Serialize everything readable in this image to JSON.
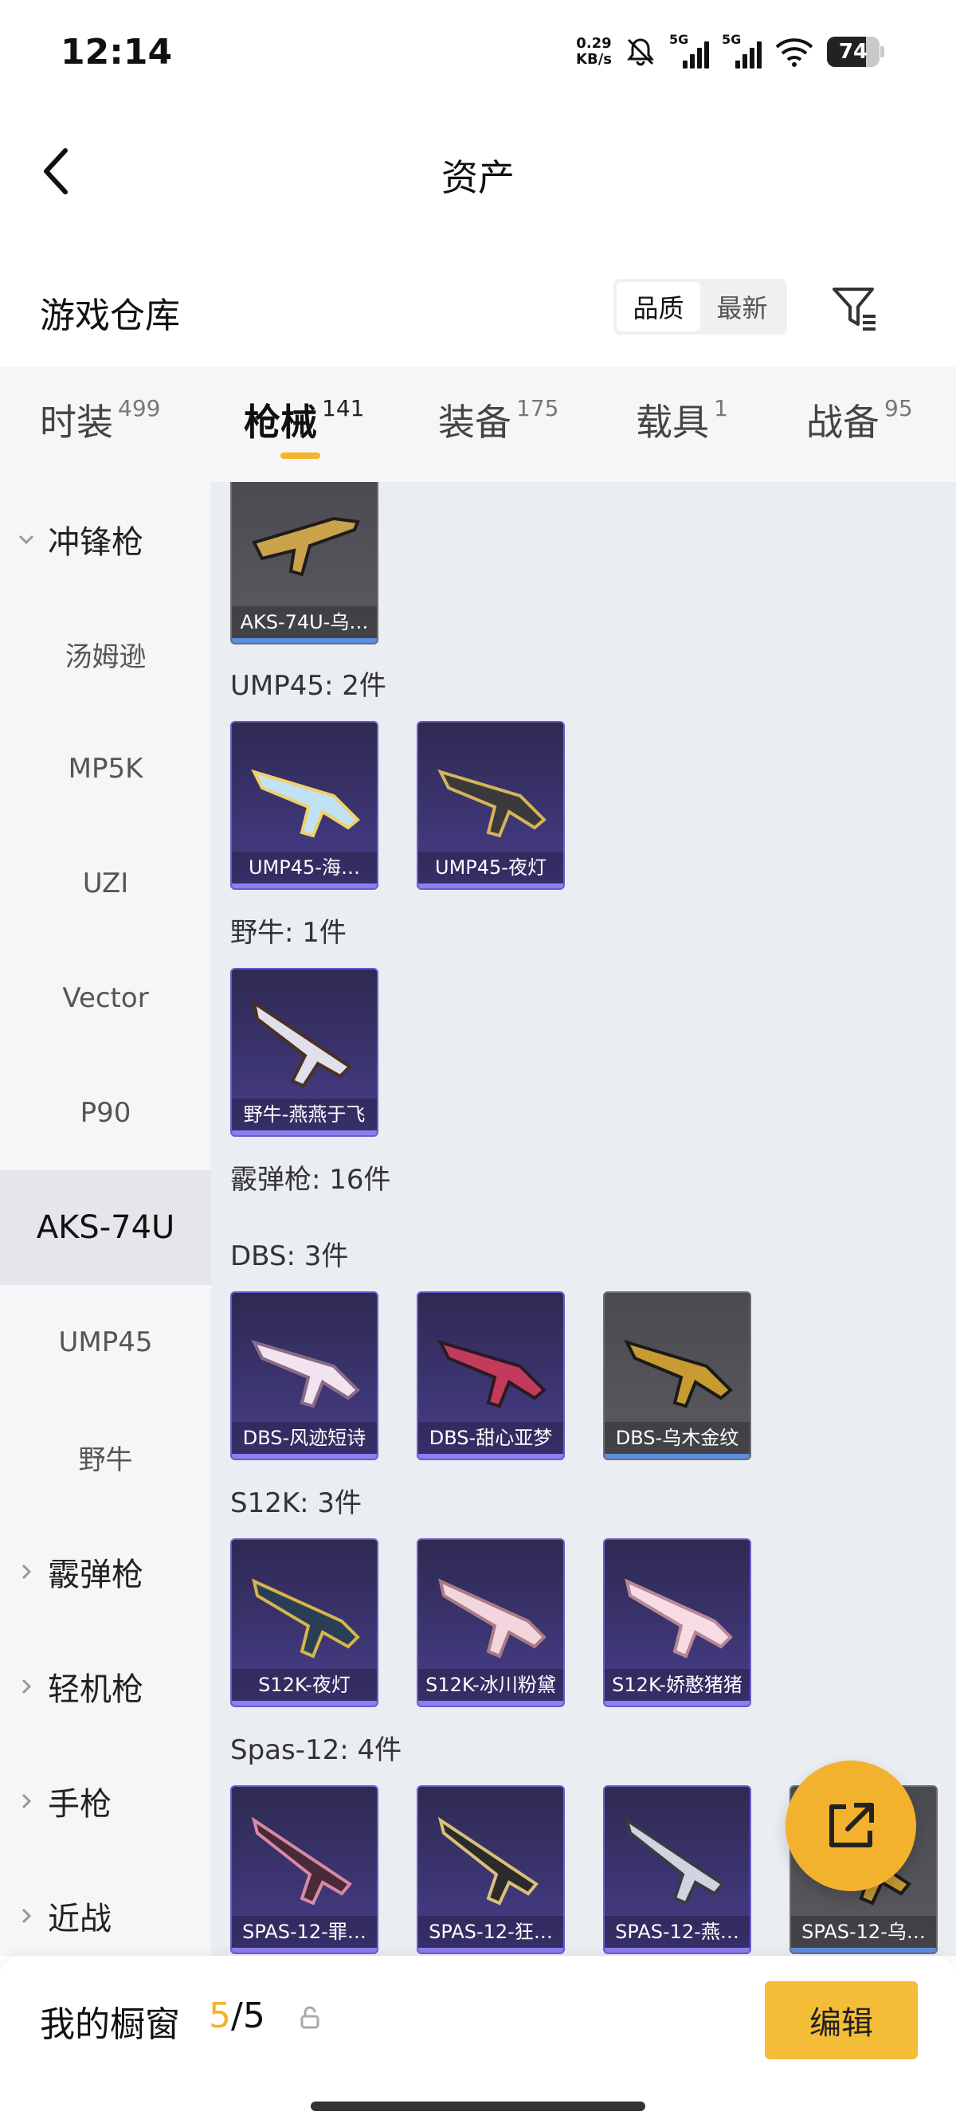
{
  "status_bar": {
    "time": "12:14",
    "net_speed_value": "0.29",
    "net_speed_unit": "KB/s",
    "signal_1": "5G",
    "signal_2": "5G",
    "battery": "74",
    "icons": [
      "mute-bell-icon",
      "signal-icon",
      "signal-icon",
      "wifi-icon",
      "battery-icon"
    ]
  },
  "header": {
    "title": "资产",
    "back_icon": "chevron-left-icon"
  },
  "section": {
    "title": "游戏仓库",
    "sort_options": [
      "品质",
      "最新"
    ],
    "active_sort": "品质",
    "filter_icon": "filter-icon"
  },
  "tabs": [
    {
      "label": "时装",
      "count": "499"
    },
    {
      "label": "枪械",
      "count": "141"
    },
    {
      "label": "装备",
      "count": "175"
    },
    {
      "label": "载具",
      "count": "1"
    },
    {
      "label": "战备",
      "count": "95"
    }
  ],
  "active_tab": "枪械",
  "sidebar": {
    "groups": [
      {
        "label": "冲锋枪",
        "expanded": true
      },
      {
        "label": "霰弹枪",
        "expanded": false
      },
      {
        "label": "轻机枪",
        "expanded": false
      },
      {
        "label": "手枪",
        "expanded": false
      },
      {
        "label": "近战",
        "expanded": false
      }
    ],
    "sub_items": [
      "汤姆逊",
      "MP5K",
      "UZI",
      "Vector",
      "P90",
      "AKS-74U",
      "UMP45",
      "野牛"
    ],
    "active_item": "AKS-74U"
  },
  "content": {
    "sections": [
      {
        "label": "",
        "items": [
          {
            "name": "AKS-74U-乌…",
            "quality": "grey"
          }
        ]
      },
      {
        "label": "UMP45: 2件",
        "items": [
          {
            "name": "UMP45-海…",
            "quality": "purple"
          },
          {
            "name": "UMP45-夜灯",
            "quality": "purple"
          }
        ]
      },
      {
        "label": "野牛: 1件",
        "items": [
          {
            "name": "野牛-燕燕于飞",
            "quality": "purple"
          }
        ]
      },
      {
        "label": "霰弹枪: 16件",
        "items": []
      },
      {
        "label": "DBS: 3件",
        "items": [
          {
            "name": "DBS-风迹短诗",
            "quality": "purple"
          },
          {
            "name": "DBS-甜心亚梦",
            "quality": "purple"
          },
          {
            "name": "DBS-乌木金纹",
            "quality": "grey"
          }
        ]
      },
      {
        "label": "S12K: 3件",
        "items": [
          {
            "name": "S12K-夜灯",
            "quality": "purple"
          },
          {
            "name": "S12K-冰川粉黛",
            "quality": "purple"
          },
          {
            "name": "S12K-娇憨猪猪",
            "quality": "purple"
          }
        ]
      },
      {
        "label": "Spas-12: 4件",
        "items": [
          {
            "name": "SPAS-12-罪…",
            "quality": "purple"
          },
          {
            "name": "SPAS-12-狂…",
            "quality": "purple"
          },
          {
            "name": "SPAS-12-燕…",
            "quality": "purple"
          },
          {
            "name": "SPAS-12-乌…",
            "quality": "grey"
          }
        ]
      }
    ]
  },
  "fab": {
    "icon": "share-external-icon"
  },
  "bottom_bar": {
    "label": "我的橱窗",
    "count_current": "5",
    "count_total": "/5",
    "lock_icon": "lock-icon",
    "edit_label": "编辑"
  },
  "colors": {
    "accent": "#f4bd38",
    "purple_card": "#3b3470",
    "grey_card": "#55555a",
    "content_bg": "#eaedf1"
  }
}
